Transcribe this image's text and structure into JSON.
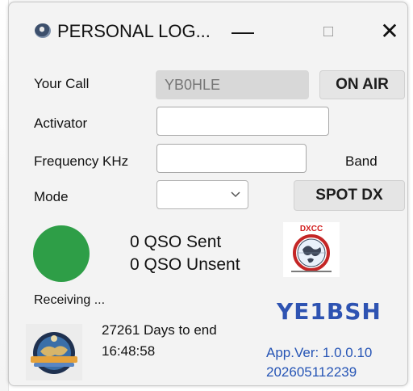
{
  "window": {
    "title": "PERSONAL LOG...",
    "controls": {
      "minimize": "—",
      "maximize": "□",
      "close": "✕"
    }
  },
  "form": {
    "your_call_label": "Your Call",
    "your_call_value": "YB0HLE",
    "activator_label": "Activator",
    "activator_value": "",
    "frequency_label": "Frequency KHz",
    "frequency_value": "",
    "band_label": "Band",
    "mode_label": "Mode",
    "mode_value": ""
  },
  "buttons": {
    "on_air": "ON AIR",
    "spot_dx": "SPOT DX"
  },
  "status": {
    "qso_sent": "0 QSO Sent",
    "qso_unsent": "0 QSO Unsent",
    "receiving": "Receiving ...",
    "indicator_color": "#2e9e47"
  },
  "dxcc": {
    "logo_text": "DXCC"
  },
  "footer": {
    "callsign_logo": "YE1BSH",
    "days_to_end": "27261 Days to end",
    "clock": "16:48:58",
    "app_version": "App.Ver: 1.0.0.10",
    "build": "202605112239"
  },
  "colors": {
    "accent_blue": "#2554b5",
    "status_green": "#2e9e47",
    "window_bg": "#f3f3f3"
  },
  "icons": {
    "app": "satellite-dish-icon",
    "mode_dropdown": "chevron-down-icon",
    "dxcc": "dxcc-globe-logo",
    "footer": "radio-globe-logo"
  }
}
